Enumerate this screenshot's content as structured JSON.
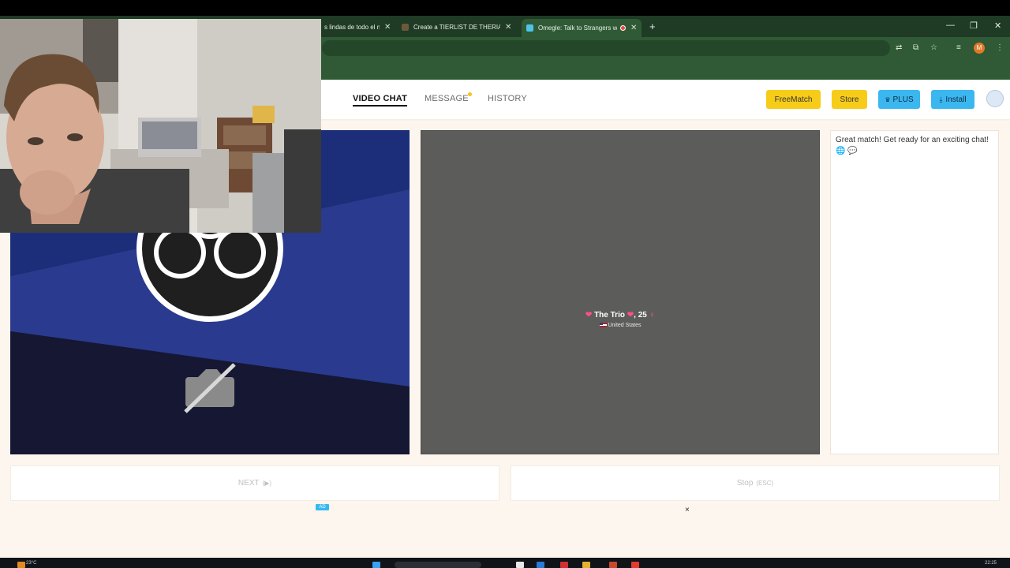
{
  "browser": {
    "tabs": [
      {
        "title": "s lindas de todo el m",
        "active": false
      },
      {
        "title": "Create a TIERLIST DE THERIANS",
        "active": false
      },
      {
        "title": "Omegle: Talk to Strangers w",
        "active": true
      }
    ],
    "icons": {
      "translate": "translate-icon",
      "install_app": "install-app-icon",
      "bookmark": "star-icon",
      "media": "media-control-icon",
      "profile": "M",
      "menu": "kebab-menu-icon"
    }
  },
  "nav": {
    "video_chat": "VIDEO CHAT",
    "message": "MESSAGE",
    "history": "HISTORY"
  },
  "header_buttons": {
    "freematch": "FreeMatch",
    "store": "Store",
    "plus": "PLUS",
    "install": "Install"
  },
  "remote": {
    "name": "The Trio",
    "age": ", 25",
    "country": "United States"
  },
  "chat": {
    "system_message": "Great match! Get ready for an exciting chat! 🌐 💬"
  },
  "actions": {
    "next_label": "NEXT",
    "next_hint": "(▶)",
    "stop_label": "Stop",
    "stop_hint": "(ESC)"
  },
  "ad": {
    "badge": "AD",
    "close": "×"
  },
  "taskbar": {
    "weather": "23°C",
    "clock": "22:25"
  },
  "colors": {
    "browser_frame": "#2f5a35",
    "site_bg": "#fcf6ee",
    "accent_yellow": "#f7cc19",
    "accent_blue": "#3bb7f0",
    "remote_panel": "#5c5d5b",
    "local_panel_dark": "#151733",
    "local_panel_blue": "#2a3a8e"
  }
}
